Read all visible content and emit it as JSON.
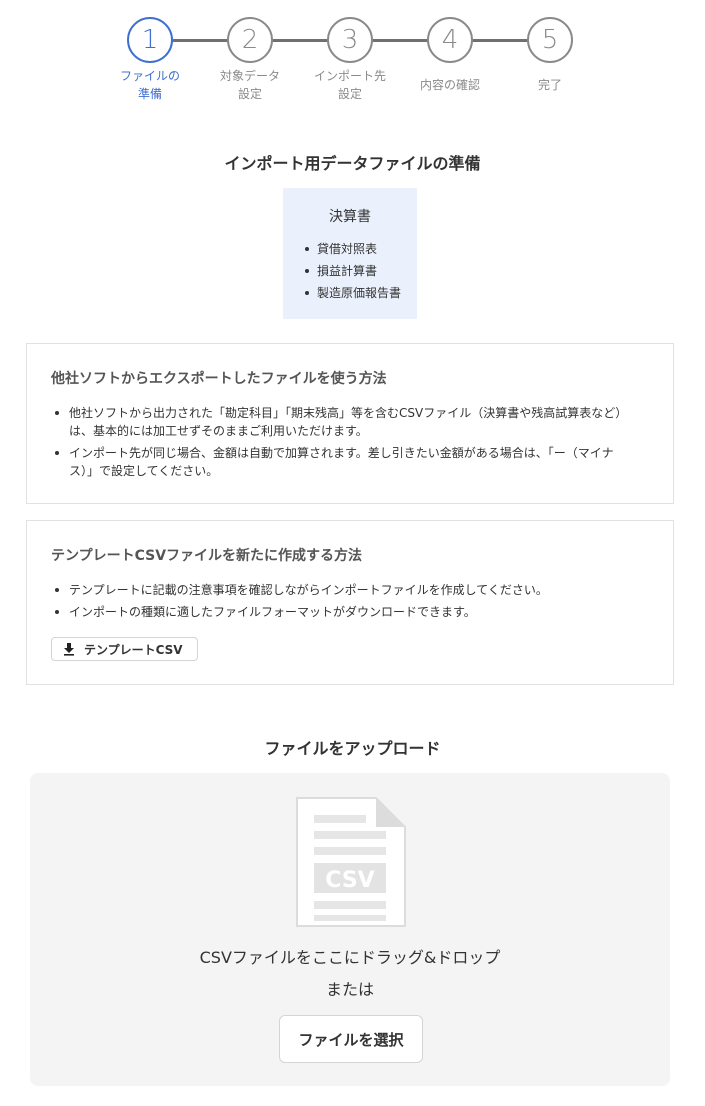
{
  "stepper": {
    "steps": [
      {
        "number": "1",
        "label_line1": "ファイルの",
        "label_line2": "準備"
      },
      {
        "number": "2",
        "label_line1": "対象データ",
        "label_line2": "設定"
      },
      {
        "number": "3",
        "label_line1": "インポート先",
        "label_line2": "設定"
      },
      {
        "number": "4",
        "label_line1": "内容の確認",
        "label_line2": ""
      },
      {
        "number": "5",
        "label_line1": "完了",
        "label_line2": ""
      }
    ],
    "active_color": "#3f6fd1"
  },
  "prepare": {
    "title": "インポート用データファイルの準備",
    "statements": {
      "title": "決算書",
      "items": [
        "貸借対照表",
        "損益計算書",
        "製造原価報告書"
      ]
    }
  },
  "export_card": {
    "title": "他社ソフトからエクスポートしたファイルを使う方法",
    "bullets": [
      {
        "line1": "他社ソフトから出力された「勘定科目」「期末残高」等を含むCSVファイル（決算書や残高試算表など）",
        "line2": "は、基本的には加工せずそのままご利用いただけます。"
      },
      {
        "line1": "インポート先が同じ場合、金額は自動で加算されます。差し引きたい金額がある場合は、「ー（マイナ",
        "line2": "ス）」で設定してください。"
      }
    ]
  },
  "template_card": {
    "title": "テンプレートCSVファイルを新たに作成する方法",
    "bullets": [
      "テンプレートに記載の注意事項を確認しながらインポートファイルを作成してください。",
      "インポートの種類に適したファイルフォーマットがダウンロードできます。"
    ],
    "button_label": "テンプレートCSV",
    "button_icon": "download-icon"
  },
  "upload": {
    "title": "ファイルをアップロード",
    "icon_text": "CSV",
    "drop_text": "CSVファイルをここにドラッグ&ドロップ",
    "or_text": "または",
    "select_button_label": "ファイルを選択"
  }
}
